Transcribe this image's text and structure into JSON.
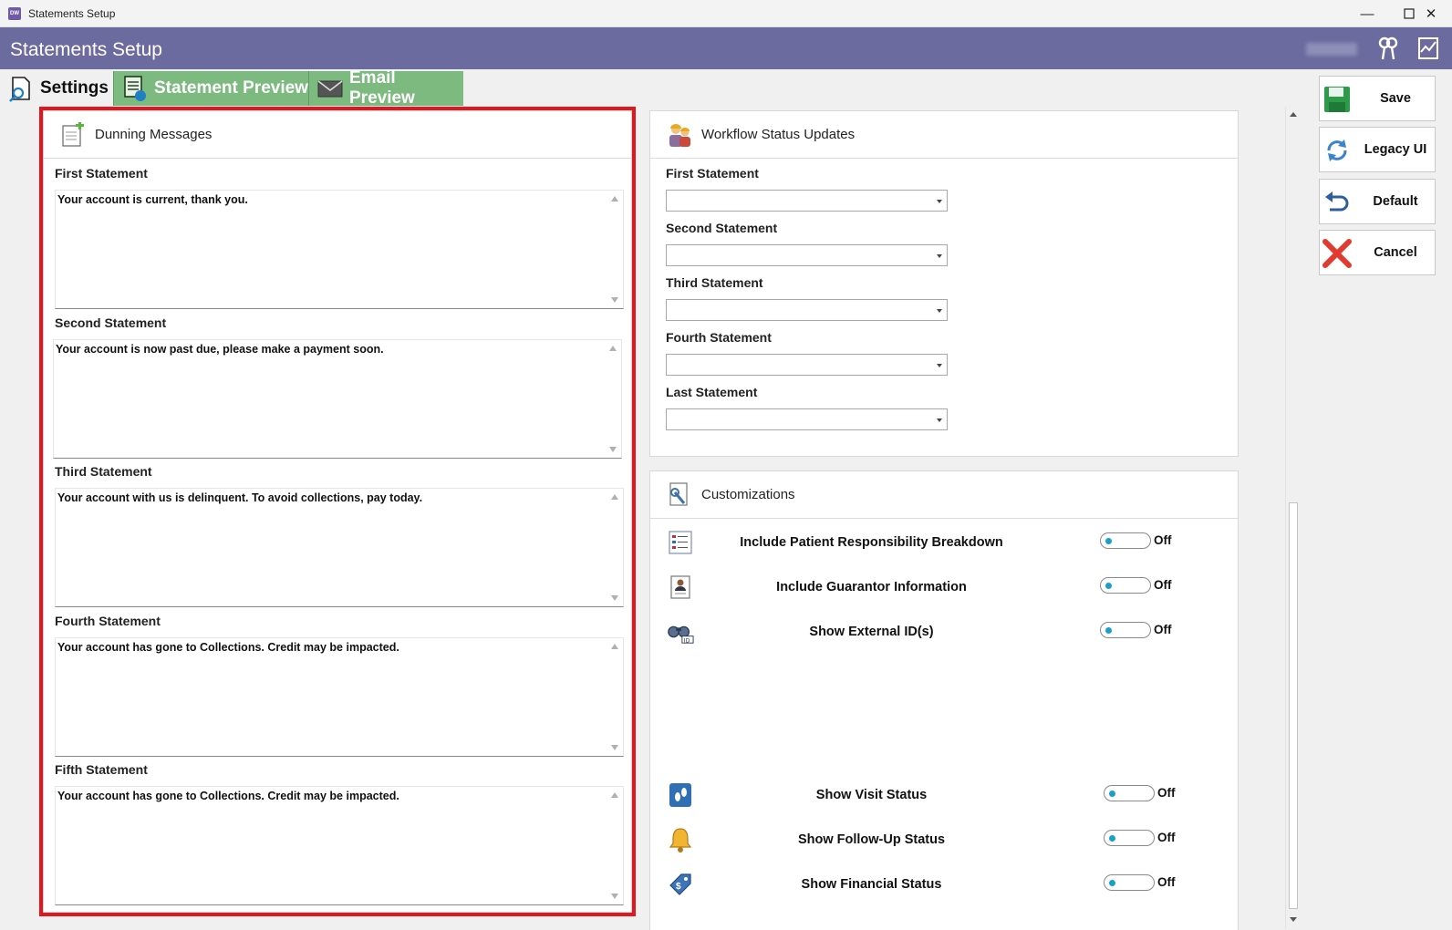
{
  "window": {
    "title": "Statements Setup",
    "minimize": "—",
    "maximize": "☐",
    "close": "✕"
  },
  "header": {
    "title": "Statements Setup"
  },
  "tabs": [
    {
      "label": "Settings"
    },
    {
      "label": "Statement Preview"
    },
    {
      "label": "Email Preview"
    }
  ],
  "dunning": {
    "title": "Dunning Messages",
    "items": [
      {
        "label": "First Statement",
        "value": "Your account is current, thank you."
      },
      {
        "label": "Second Statement",
        "value": "Your account is now past due, please make a payment soon."
      },
      {
        "label": "Third Statement",
        "value": "Your account with us is delinquent. To avoid collections, pay today."
      },
      {
        "label": "Fourth Statement",
        "value": "Your account has gone to Collections. Credit may be impacted."
      },
      {
        "label": "Fifth Statement",
        "value": "Your account has gone to Collections. Credit may be impacted."
      }
    ]
  },
  "workflow": {
    "title": "Workflow Status Updates",
    "items": [
      {
        "label": "First Statement",
        "value": ""
      },
      {
        "label": "Second Statement",
        "value": ""
      },
      {
        "label": "Third Statement",
        "value": ""
      },
      {
        "label": "Fourth Statement",
        "value": ""
      },
      {
        "label": "Last Statement",
        "value": ""
      }
    ]
  },
  "customizations": {
    "title": "Customizations",
    "items": [
      {
        "label": "Include Patient Responsibility Breakdown",
        "state": "Off",
        "icon": "list-icon"
      },
      {
        "label": "Include Guarantor Information",
        "state": "Off",
        "icon": "guarantor-icon"
      },
      {
        "label": "Show External ID(s)",
        "state": "Off",
        "icon": "binoculars-id-icon"
      },
      {
        "label": "Show Visit Status",
        "state": "Off",
        "icon": "footprints-icon"
      },
      {
        "label": "Show Follow-Up Status",
        "state": "Off",
        "icon": "bell-icon"
      },
      {
        "label": "Show Financial Status",
        "state": "Off",
        "icon": "price-tag-icon"
      }
    ]
  },
  "actions": {
    "save": "Save",
    "legacy": "Legacy UI",
    "default": "Default",
    "cancel": "Cancel"
  },
  "colors": {
    "header": "#6b6b9f",
    "tab_inactive": "#7cba7f",
    "highlight_frame": "#e3161f",
    "toggle_knob": "#1aa0c8"
  }
}
